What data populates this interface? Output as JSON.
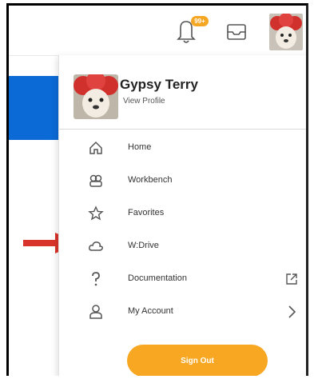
{
  "header": {
    "notification_badge": "99+"
  },
  "profile": {
    "name": "Gypsy Terry",
    "link_label": "View Profile"
  },
  "menu": {
    "items": [
      {
        "label": "Home",
        "icon": "home-icon"
      },
      {
        "label": "Workbench",
        "icon": "workbench-icon"
      },
      {
        "label": "Favorites",
        "icon": "star-icon"
      },
      {
        "label": "W:Drive",
        "icon": "cloud-icon"
      },
      {
        "label": "Documentation",
        "icon": "question-icon"
      },
      {
        "label": "My Account",
        "icon": "person-icon"
      }
    ]
  },
  "signout_label": "Sign Out",
  "colors": {
    "accent": "#f7a721",
    "brand_blue": "#0b6ad6",
    "arrow_red": "#d9342b"
  }
}
